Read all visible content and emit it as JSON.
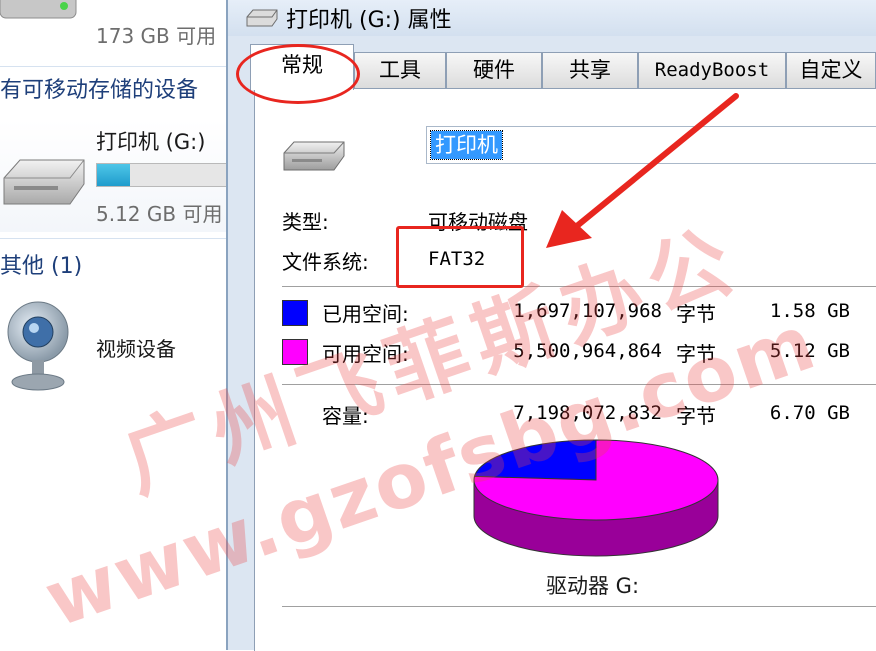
{
  "left_pane": {
    "top_drive_size": "173 GB 可用",
    "group_removable": "有可移动存储的设备",
    "drive_name": "打印机 (G:)",
    "drive_free": "5.12 GB 可用",
    "drive_usage_fraction": 0.236,
    "group_other": "其他 (1)",
    "webcam_label": "视频设备"
  },
  "dialog": {
    "title": "打印机 (G:) 属性",
    "tabs": [
      "常规",
      "工具",
      "硬件",
      "共享",
      "ReadyBoost",
      "自定义"
    ],
    "active_tab": "常规",
    "name_value": "打印机",
    "type_label": "类型:",
    "type_value": "可移动磁盘",
    "fs_label": "文件系统:",
    "fs_value": "FAT32",
    "used_label": "已用空间:",
    "used_bytes": "1,697,107,968",
    "used_unit": "字节",
    "used_gb": "1.58 GB",
    "free_label": "可用空间:",
    "free_bytes": "5,500,964,864",
    "free_unit": "字节",
    "free_gb": "5.12 GB",
    "capacity_label": "容量:",
    "capacity_bytes": "7,198,072,832",
    "capacity_unit": "字节",
    "capacity_gb": "6.70 GB",
    "drive_letter_label": "驱动器 G:"
  },
  "colors": {
    "used": "#0000ff",
    "free": "#ff00ff",
    "annotation": "#e8261f"
  },
  "chart_data": {
    "type": "pie",
    "values": [
      1697107968,
      5500964864
    ],
    "colors": [
      "#0000ff",
      "#ff00ff"
    ]
  },
  "watermark": {
    "chinese": "广州飞菲斯办公",
    "url": "www.gzofsbg.com"
  }
}
